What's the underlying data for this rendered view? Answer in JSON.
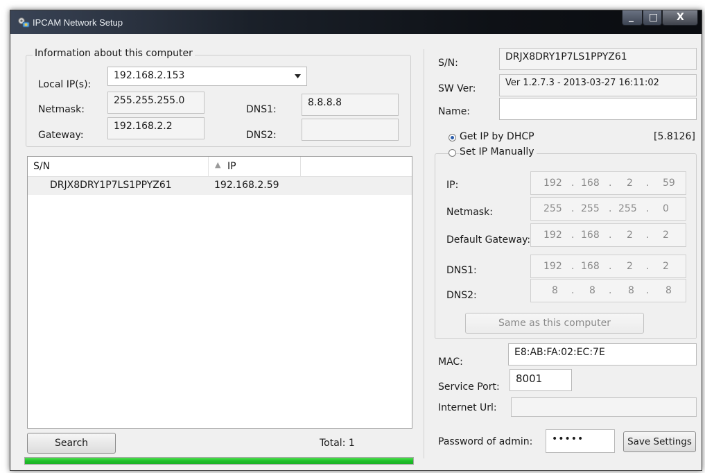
{
  "window": {
    "title": "IPCAM Network Setup",
    "controls": {
      "minimize": "_",
      "maximize": "□",
      "close": "X"
    }
  },
  "computer_info": {
    "group_title": "Information about this computer",
    "local_ip_label": "Local IP(s):",
    "local_ip_value": "192.168.2.153",
    "netmask_label": "Netmask:",
    "netmask_value": "255.255.255.0",
    "gateway_label": "Gateway:",
    "gateway_value": "192.168.2.2",
    "dns1_label": "DNS1:",
    "dns1_value": "8.8.8.8",
    "dns2_label": "DNS2:",
    "dns2_value": ""
  },
  "device_list": {
    "columns": [
      "S/N",
      "IP"
    ],
    "sort_indicator": "▲",
    "rows": [
      {
        "sn": "DRJX8DRY1P7LS1PPYZ61",
        "ip": "192.168.2.59"
      }
    ]
  },
  "footer": {
    "search_label": "Search",
    "total_text": "Total: 1",
    "progress": 1.0
  },
  "device": {
    "sn_label": "S/N:",
    "sn_value": "DRJX8DRY1P7LS1PPYZ61",
    "sw_label": "SW Ver:",
    "sw_value": "Ver 1.2.7.3 - 2013-03-27 16:11:02",
    "name_label": "Name:",
    "name_value": "",
    "dhcp_label": "Get IP by DHCP",
    "manual_label": "Set IP Manually",
    "version_tag": "[5.8126]",
    "ip_label": "IP:",
    "ip": [
      "192",
      "168",
      "2",
      "59"
    ],
    "netmask_label": "Netmask:",
    "netmask": [
      "255",
      "255",
      "255",
      "0"
    ],
    "gateway_label": "Default Gateway:",
    "gateway": [
      "192",
      "168",
      "2",
      "2"
    ],
    "dns1_label": "DNS1:",
    "dns1": [
      "192",
      "168",
      "2",
      "2"
    ],
    "dns2_label": "DNS2:",
    "dns2": [
      "8",
      "8",
      "8",
      "8"
    ],
    "same_button": "Same as this computer",
    "mac_label": "MAC:",
    "mac_value": "E8:AB:FA:02:EC:7E",
    "port_label": "Service Port:",
    "port_value": "8001",
    "url_label": "Internet Url:",
    "url_value": "",
    "password_label": "Password of admin:",
    "password_value": "•••••",
    "save_button": "Save Settings"
  },
  "colors": {
    "progress": "#1fbf2a",
    "title_bar": "#0e1116",
    "radio_selected": "#2a5caa"
  },
  "icons": {
    "app": "camera-gear-icon",
    "dropdown": "dropdown-arrow-icon",
    "sort": "sort-up-icon"
  }
}
